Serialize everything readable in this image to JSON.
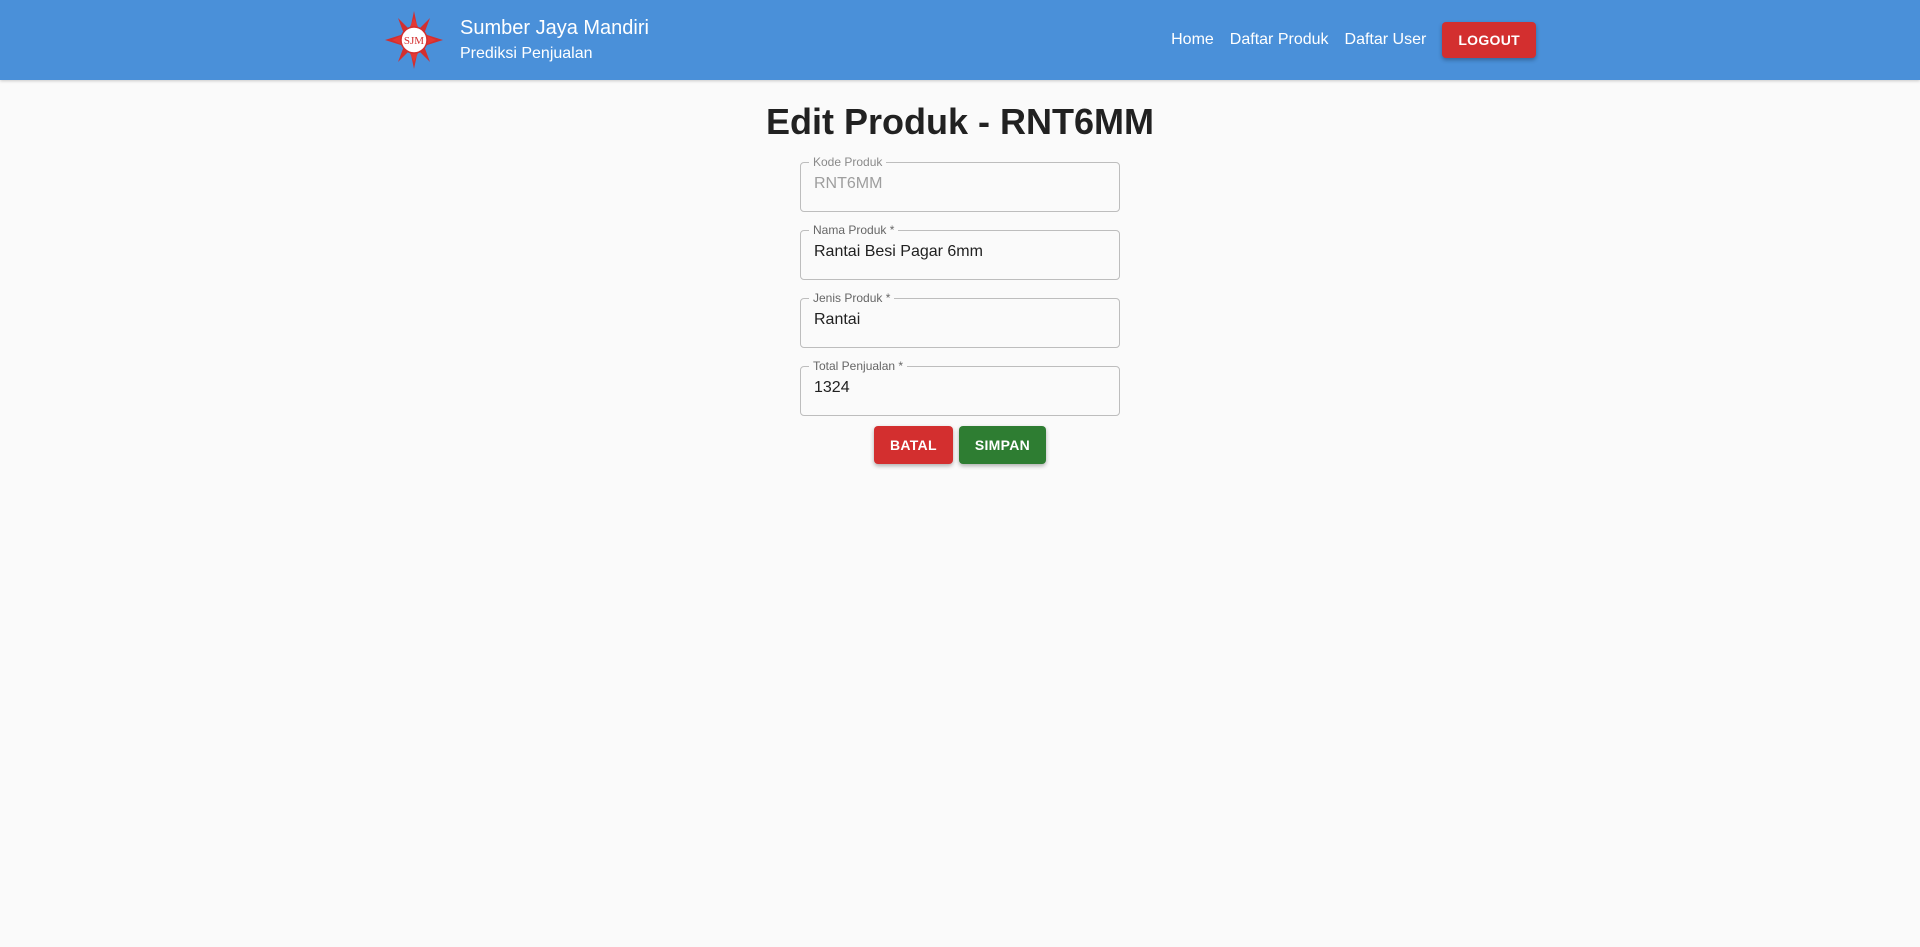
{
  "header": {
    "brand_title": "Sumber Jaya Mandiri",
    "brand_subtitle": "Prediksi Penjualan",
    "logo_text": "SJM",
    "nav": [
      {
        "label": "Home"
      },
      {
        "label": "Daftar Produk"
      },
      {
        "label": "Daftar User"
      }
    ],
    "logout_label": "LOGOUT",
    "background_color": "#4a90d9"
  },
  "page": {
    "title": "Edit Produk - RNT6MM"
  },
  "form": {
    "kode_produk": {
      "label": "Kode Produk",
      "value": "RNT6MM",
      "disabled": true
    },
    "nama_produk": {
      "label": "Nama Produk *",
      "value": "Rantai Besi Pagar 6mm"
    },
    "jenis_produk": {
      "label": "Jenis Produk *",
      "value": "Rantai"
    },
    "total_penjualan": {
      "label": "Total Penjualan *",
      "value": "1324"
    }
  },
  "actions": {
    "cancel_label": "BATAL",
    "save_label": "SIMPAN",
    "cancel_color": "#d32f2f",
    "save_color": "#2e7d32"
  }
}
